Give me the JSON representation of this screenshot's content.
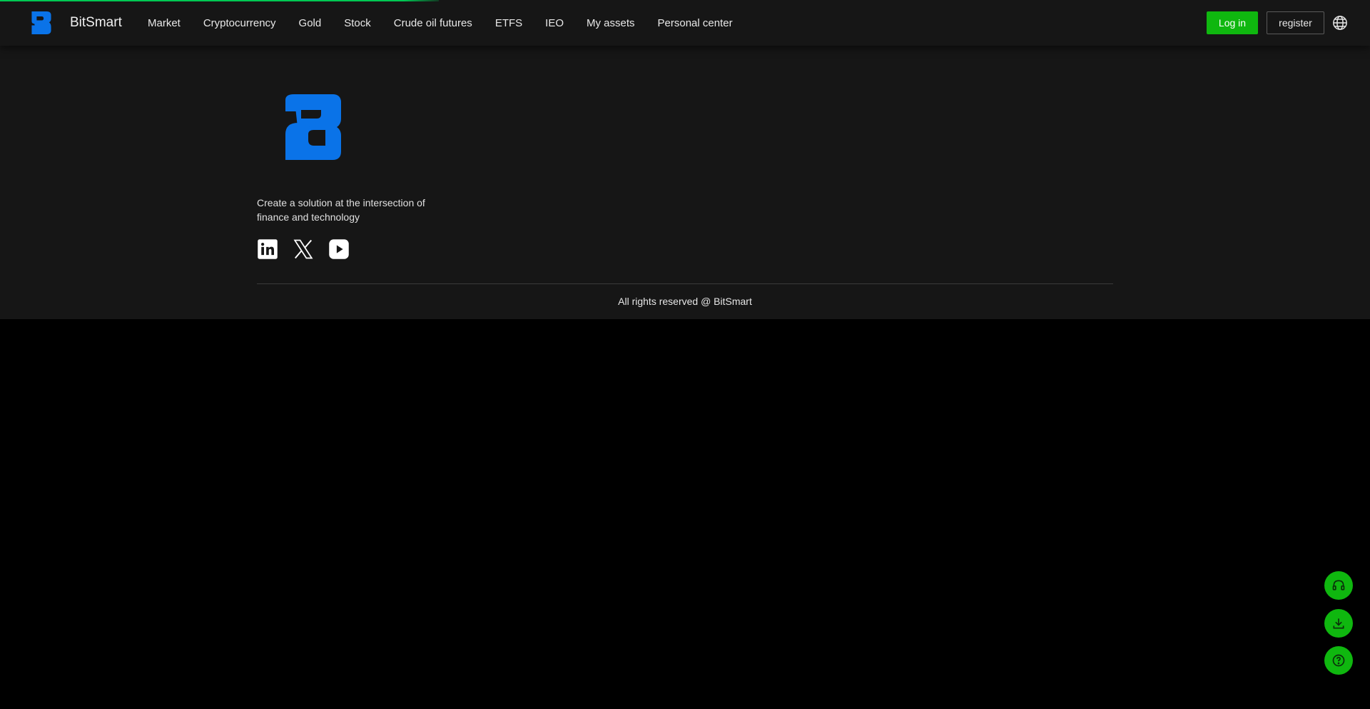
{
  "brand": {
    "name": "BitSmart",
    "logo_icon": "bitsmart-logo",
    "logo_color": "#0a73e8"
  },
  "nav": {
    "items": [
      {
        "label": "Market"
      },
      {
        "label": "Cryptocurrency"
      },
      {
        "label": "Gold"
      },
      {
        "label": "Stock"
      },
      {
        "label": "Crude oil futures"
      },
      {
        "label": "ETFS"
      },
      {
        "label": "IEO"
      },
      {
        "label": "My assets"
      },
      {
        "label": "Personal center"
      }
    ]
  },
  "header": {
    "login_label": "Log in",
    "register_label": "register",
    "language_icon": "globe-icon",
    "accent_color": "#0fb70f"
  },
  "footer": {
    "tagline": "Create a solution at the intersection of finance and technology",
    "social": [
      {
        "icon": "linkedin-icon"
      },
      {
        "icon": "x-twitter-icon"
      },
      {
        "icon": "youtube-icon"
      }
    ],
    "copyright": "All rights reserved @ BitSmart"
  },
  "floating_actions": [
    {
      "icon": "headset-icon"
    },
    {
      "icon": "download-icon"
    },
    {
      "icon": "help-circle-icon"
    }
  ]
}
